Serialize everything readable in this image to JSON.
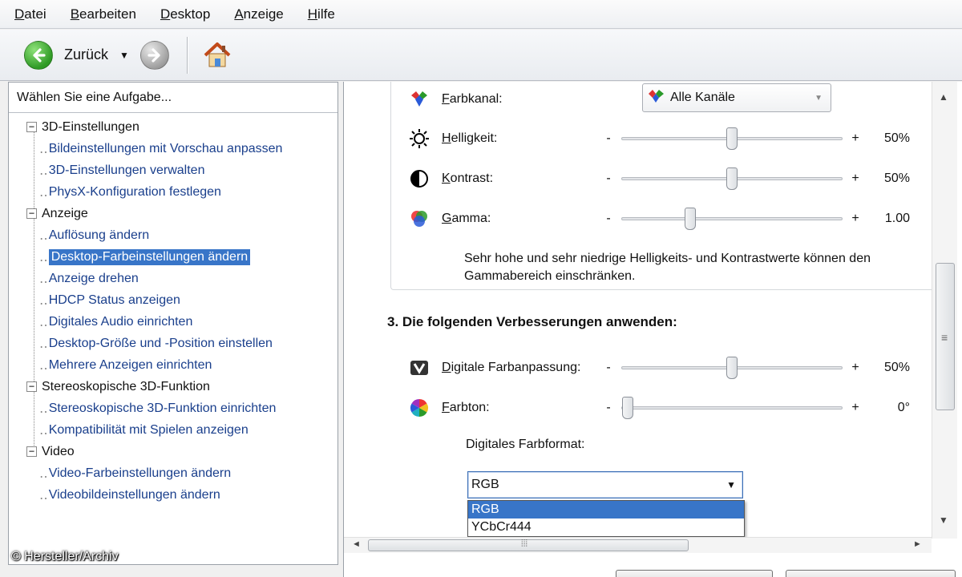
{
  "menubar": {
    "items": [
      "Datei",
      "Bearbeiten",
      "Desktop",
      "Anzeige",
      "Hilfe"
    ]
  },
  "toolbar": {
    "back_label": "Zurück"
  },
  "leftpane": {
    "header": "Wählen Sie eine Aufgabe...",
    "categories": [
      {
        "label": "3D-Einstellungen",
        "items": [
          "Bildeinstellungen mit Vorschau anpassen",
          "3D-Einstellungen verwalten",
          "PhysX-Konfiguration festlegen"
        ]
      },
      {
        "label": "Anzeige",
        "items": [
          "Auflösung ändern",
          "Desktop-Farbeinstellungen ändern",
          "Anzeige drehen",
          "HDCP Status anzeigen",
          "Digitales Audio einrichten",
          "Desktop-Größe und -Position einstellen",
          "Mehrere Anzeigen einrichten"
        ]
      },
      {
        "label": "Stereoskopische 3D-Funktion",
        "items": [
          "Stereoskopische 3D-Funktion einrichten",
          "Kompatibilität mit Spielen anzeigen"
        ]
      },
      {
        "label": "Video",
        "items": [
          "Video-Farbeinstellungen ändern",
          "Videobildeinstellungen ändern"
        ]
      }
    ],
    "selected_item": "Desktop-Farbeinstellungen ändern"
  },
  "copyright": "© Hersteller/Archiv",
  "settings": {
    "farbkanal": {
      "label": "Farbkanal:",
      "value": "Alle Kanäle"
    },
    "helligkeit": {
      "label": "Helligkeit:",
      "value": "50%",
      "level": 0.5
    },
    "kontrast": {
      "label": "Kontrast:",
      "value": "50%",
      "level": 0.5
    },
    "gamma": {
      "label": "Gamma:",
      "value": "1.00",
      "level": 0.3
    },
    "note": "Sehr hohe und sehr niedrige Helligkeits- und Kontrastwerte können den Gammabereich einschränken.",
    "section3_heading": "3. Die folgenden Verbesserungen anwenden:",
    "digitale_farbanpassung": {
      "label": "Digitale Farbanpassung:",
      "value": "50%",
      "level": 0.5
    },
    "farbton": {
      "label": "Farbton:",
      "value": "0°",
      "level": 0.0
    },
    "digitales_farbformat": {
      "label": "Digitales Farbformat:",
      "value": "RGB",
      "options": [
        "RGB",
        "YCbCr444"
      ]
    },
    "slider_minus": "-",
    "slider_plus": "+"
  },
  "colors": {
    "selection": "#3875c8",
    "link": "#1a3f8c"
  }
}
